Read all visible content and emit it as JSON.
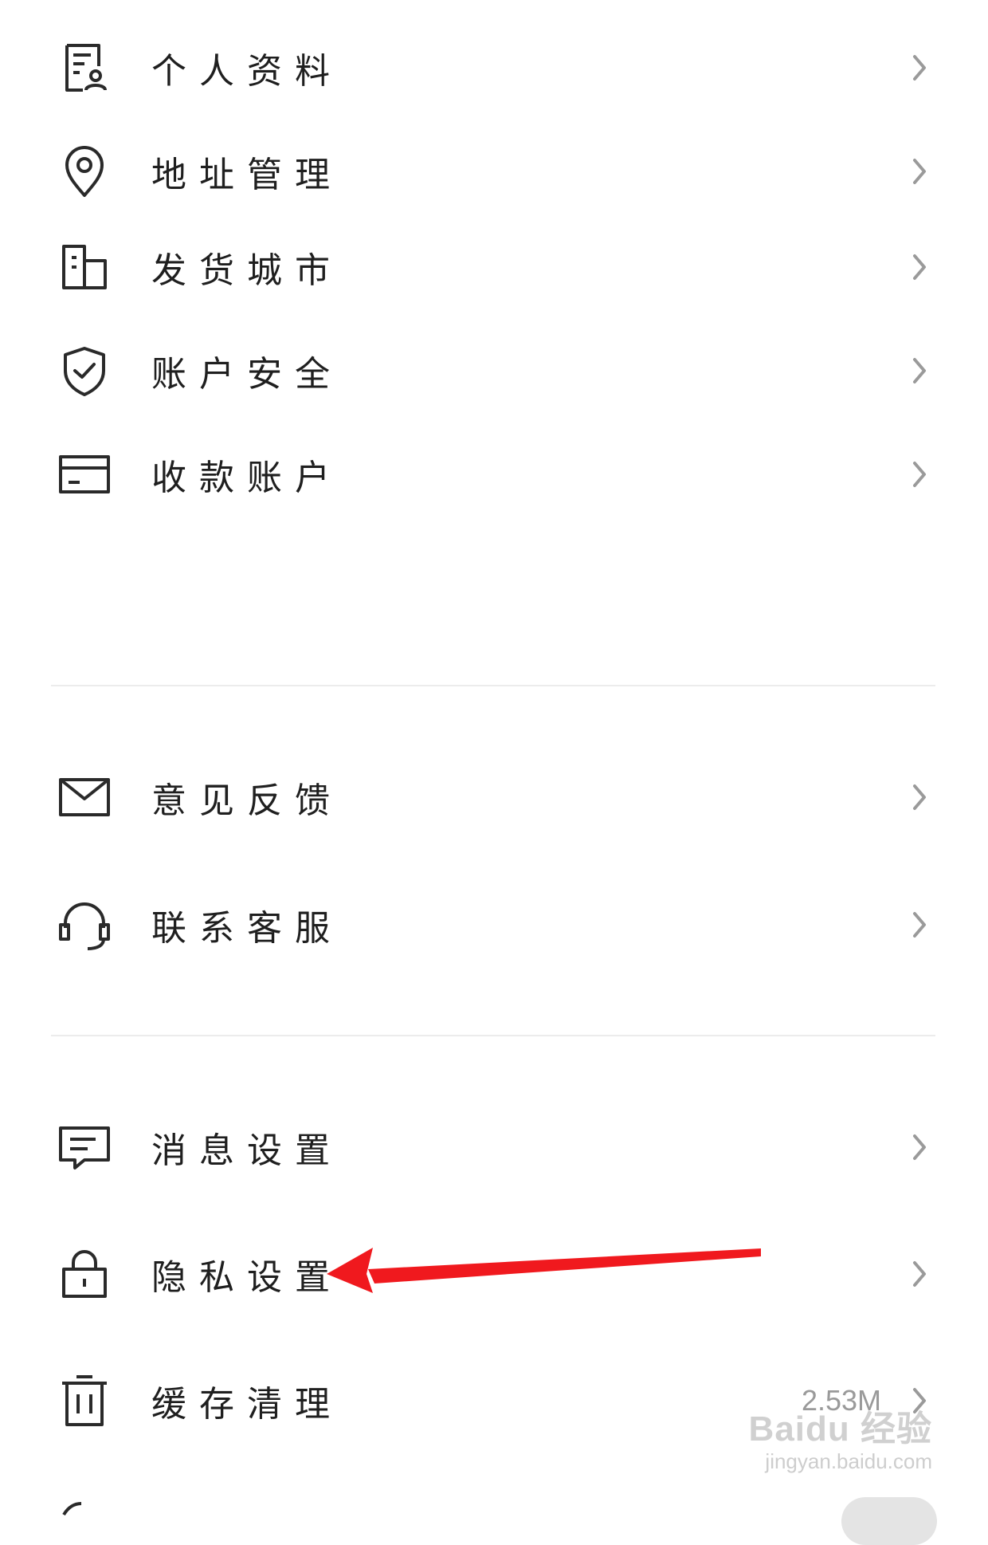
{
  "menu": {
    "group1": [
      {
        "label": "个人资料",
        "icon": "profile-card-icon"
      },
      {
        "label": "地址管理",
        "icon": "location-pin-icon"
      },
      {
        "label": "发货城市",
        "icon": "building-icon"
      },
      {
        "label": "账户安全",
        "icon": "shield-check-icon"
      },
      {
        "label": "收款账户",
        "icon": "card-icon"
      }
    ],
    "group2": [
      {
        "label": "意见反馈",
        "icon": "mail-icon"
      },
      {
        "label": "联系客服",
        "icon": "headset-icon"
      }
    ],
    "group3": [
      {
        "label": "消息设置",
        "icon": "message-icon"
      },
      {
        "label": "隐私设置",
        "icon": "lock-icon"
      },
      {
        "label": "缓存清理",
        "icon": "trash-icon",
        "value": "2.53M"
      }
    ]
  },
  "annotation": {
    "color": "#f0191e"
  },
  "watermark": {
    "logo": "Baidu 经验",
    "url": "jingyan.baidu.com"
  },
  "colors": {
    "text": "#1f1f1f",
    "chevron": "#9a9a9a",
    "divider": "#ececec"
  }
}
